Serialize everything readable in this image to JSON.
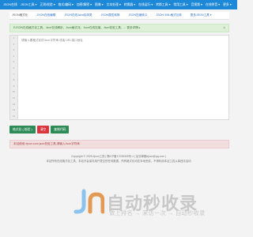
{
  "topnav": [
    "JSON在线",
    "JSON工具 ▾",
    "正则/校验 ▾",
    "格式/编码 ▾",
    "加密/解密 ▾",
    "图像 ▾",
    "文本处理 ▾",
    "转换器 ▾",
    "在线运行 ▾",
    "转换工具 ▾",
    "常用工具 ▾",
    "音视频 ▾",
    "在线拼音 ▾",
    "更多 ▾"
  ],
  "subnav": [
    "JSON格式化",
    "JSON在线编辑",
    "JSON在线Java实体类",
    "JSON属性转换",
    "JSON压缩转义",
    "JSON XML格式互转",
    "更多JSON工具 ▾"
  ],
  "notice": {
    "text": "EJSON在线格式化工具，Json在线解析，Json格式化，Json在线压缩，Json校验工具，... 更多详情 ▸",
    "close": "×"
  },
  "editor": {
    "placeholder": "请输入要格式化的Json字符串 或者 URL接口地址",
    "line_count": 14
  },
  "buttons": {
    "format": "格式化 ( 校验 )",
    "clear": "清空",
    "copy": "复制代码"
  },
  "tip": "本站使用 ejson.com json校验工具,请输入Json字符串",
  "footer": [
    "Copyright © 2025 ejson工具 | 豫ICP备17035305号-1 | 站长邮箱ejson@qq.com |",
    "本站所有在线格式化工具，本站不会保存用户提交的任何数据，所有格式化均在本地完成。不得利用本站工具从事违法活动"
  ],
  "brand": {
    "name": "自动秒收录",
    "slogan": "做上排名 → 来访一次 → 自动秒收录",
    "accent": "#1e88d8",
    "logo_color": "#c8c8c8"
  }
}
